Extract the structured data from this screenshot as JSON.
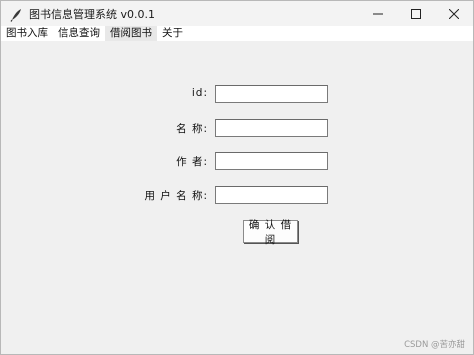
{
  "window": {
    "title": "图书信息管理系统 v0.0.1",
    "controls": {
      "minimize": "—",
      "maximize": "☐",
      "close": "✕"
    }
  },
  "menu": {
    "items": [
      {
        "label": "图书入库"
      },
      {
        "label": "信息查询"
      },
      {
        "label": "借阅图书",
        "active": true
      },
      {
        "label": "关于"
      }
    ]
  },
  "form": {
    "fields": [
      {
        "label": "id:",
        "value": ""
      },
      {
        "label": "名 称:",
        "value": ""
      },
      {
        "label": "作 者:",
        "value": ""
      },
      {
        "label": "用 户 名 称:",
        "value": ""
      }
    ],
    "confirm_label": "确 认 借阅"
  },
  "watermark": "CSDN @苦亦甜",
  "colors": {
    "window_bg": "#f0f0f0",
    "menubar_bg": "#ffffff",
    "titlebar_bg": "#f3f3f3"
  },
  "icons": {
    "app": "feather-icon"
  }
}
